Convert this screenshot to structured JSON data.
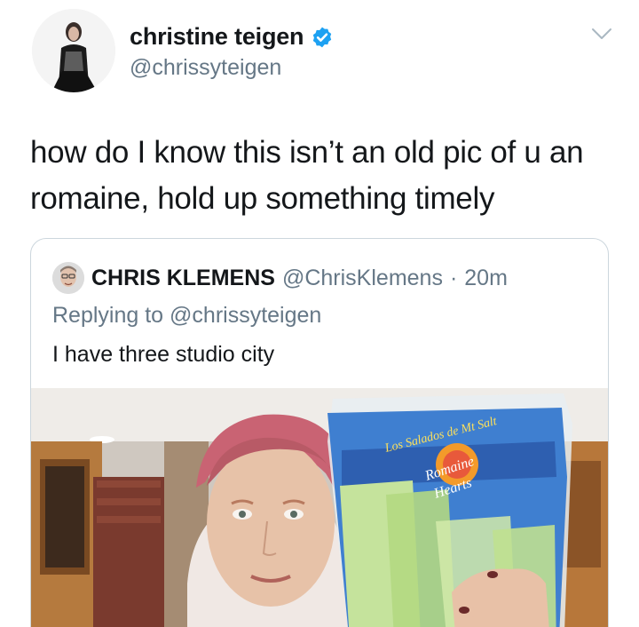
{
  "tweet": {
    "display_name": "christine teigen",
    "handle": "@chrissyteigen",
    "text": "how do I know this isn’t an old pic of u an romaine, hold up something timely",
    "verified": true,
    "icons": {
      "verified": "verified-badge-icon",
      "menu": "chevron-down-icon"
    },
    "accent_color": "#1da1f2"
  },
  "quoted_tweet": {
    "display_name": "CHRIS KLEMENS",
    "handle": "@ChrisKlemens",
    "separator": "·",
    "time": "20m",
    "replying_prefix": "Replying to",
    "replying_handle": "@chrissyteigen",
    "text": "I have three studio city",
    "media": {
      "bag_text_top": "Los Salados de Mt Salt",
      "bag_text_brand_1": "Romaine",
      "bag_text_brand_2": "Hearts"
    }
  }
}
